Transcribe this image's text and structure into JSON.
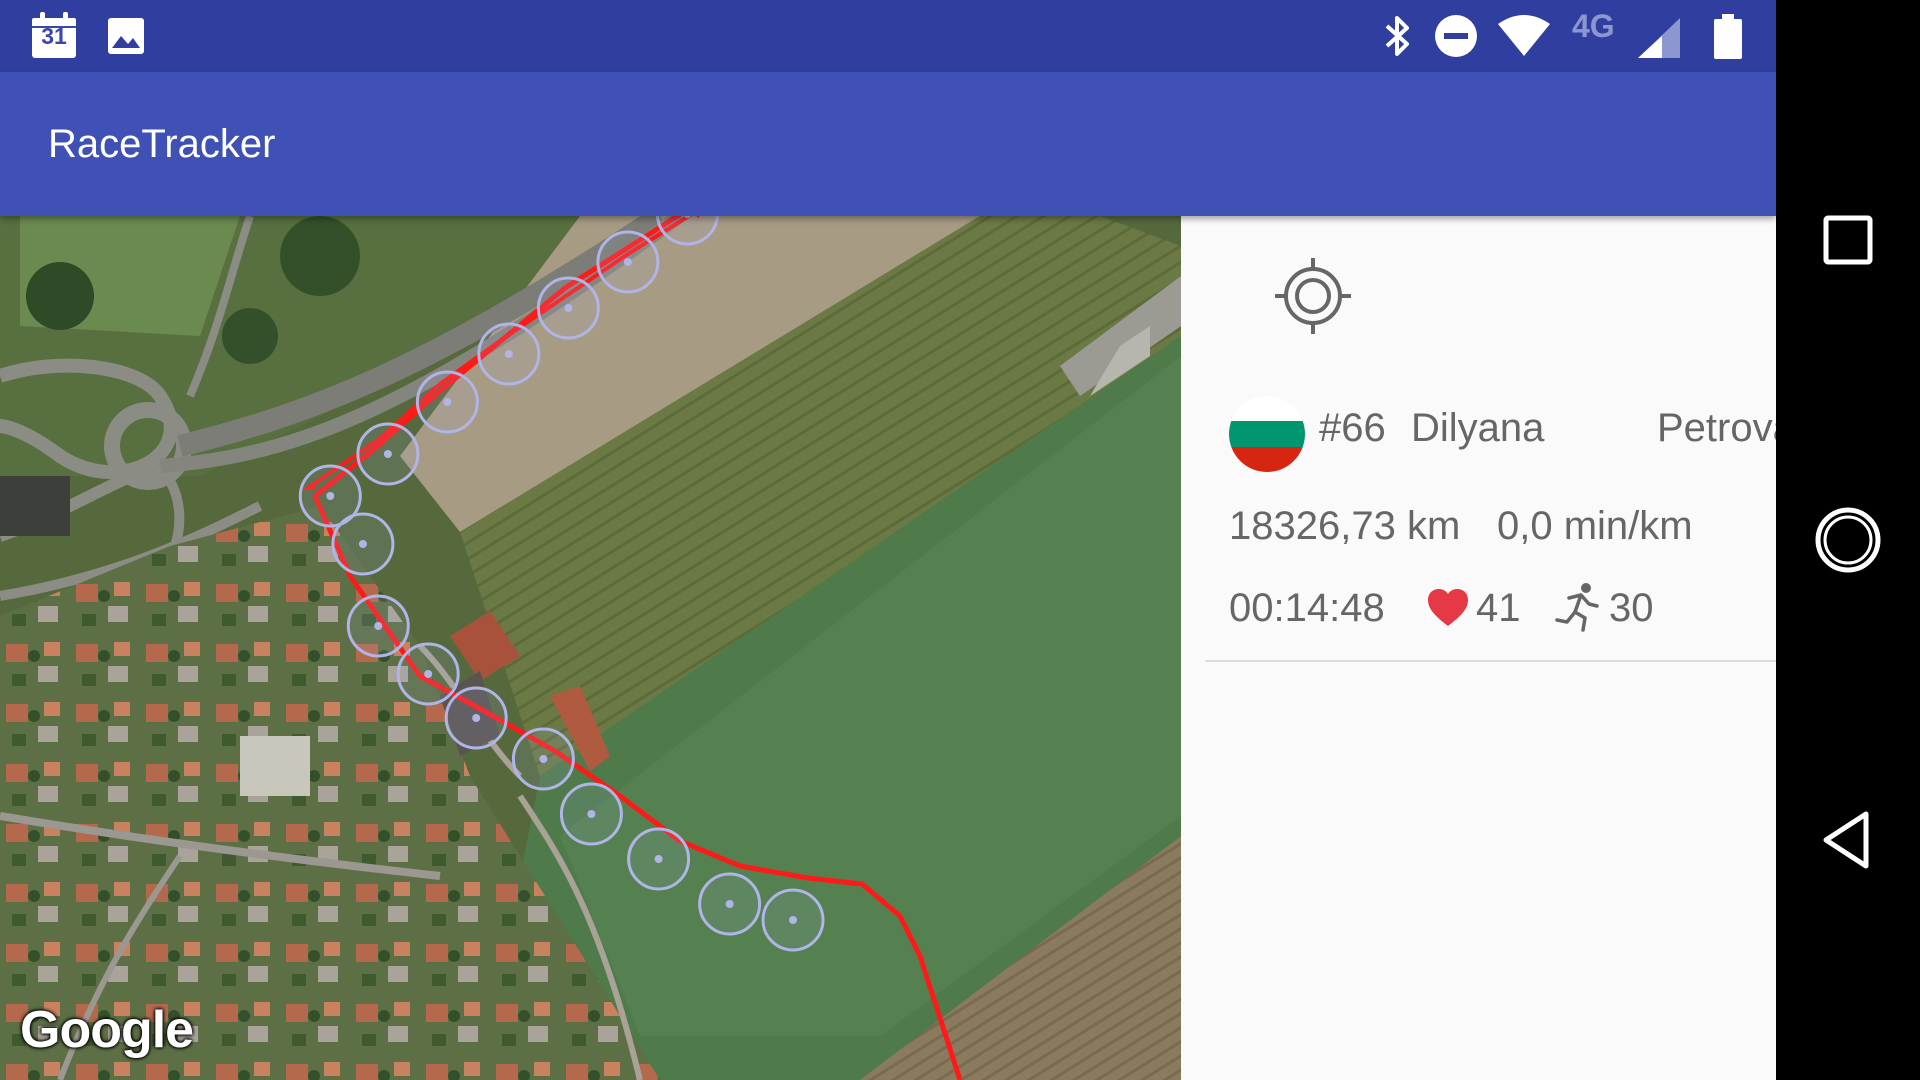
{
  "status_bar": {
    "calendar_day": "31",
    "network_type": "4G",
    "icons": [
      "calendar-icon",
      "image-icon",
      "bluetooth-icon",
      "do-not-disturb-icon",
      "wifi-icon",
      "cell-signal-icon",
      "battery-icon"
    ]
  },
  "app_bar": {
    "title": "RaceTracker"
  },
  "map": {
    "attribution": "Google",
    "route_color": "#ff1a1a",
    "checkpoint_color": "#b0b4e6"
  },
  "runner": {
    "number": "#66",
    "first_name": "Dilyana",
    "last_name": "Petrova",
    "flag_colors": [
      "#ffffff",
      "#00966e",
      "#d62612"
    ],
    "distance": "18326,73 km",
    "pace": "0,0 min/km",
    "elapsed_time": "00:14:48",
    "heart_rate": "41",
    "cadence": "30"
  },
  "colors": {
    "status_bar": "#303f9f",
    "app_bar": "#3f51b5",
    "heart": "#e53946",
    "text": "#666666"
  },
  "nav_bar": {
    "icons": [
      "recents-icon",
      "home-icon",
      "back-icon"
    ]
  }
}
